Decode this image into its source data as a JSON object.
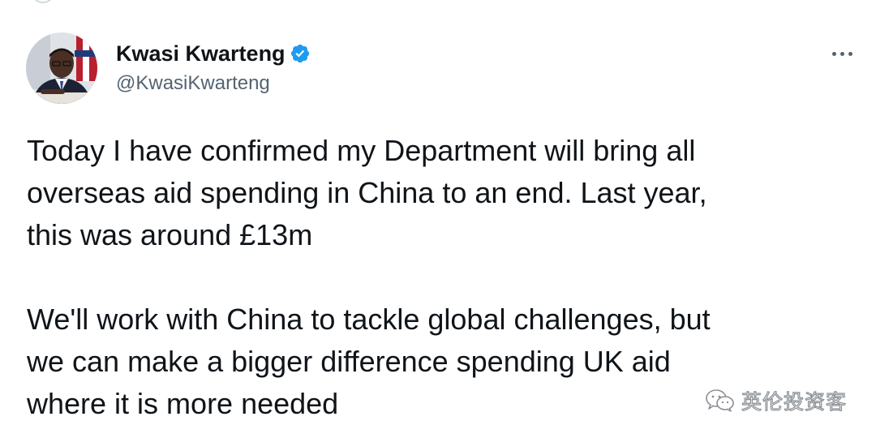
{
  "author": {
    "name": "Kwasi Kwarteng",
    "handle": "@KwasiKwarteng",
    "verified": true
  },
  "icons": {
    "verified": "verified-badge-icon",
    "more": "more-options-icon",
    "watermark": "wechat-icon"
  },
  "colors": {
    "verified_blue": "#1d9bf0",
    "text_primary": "#0f1419",
    "text_secondary": "#536471"
  },
  "tweet": {
    "paragraph1": [
      "Today I have confirmed my Department will bring all",
      "overseas aid spending in China to an end. Last year,",
      "this was around £13m"
    ],
    "paragraph2": [
      "We'll work with China to tackle global challenges, but",
      "we can make a bigger difference spending UK aid",
      "where it is more needed"
    ]
  },
  "watermark": {
    "text": "英伦投资客"
  }
}
